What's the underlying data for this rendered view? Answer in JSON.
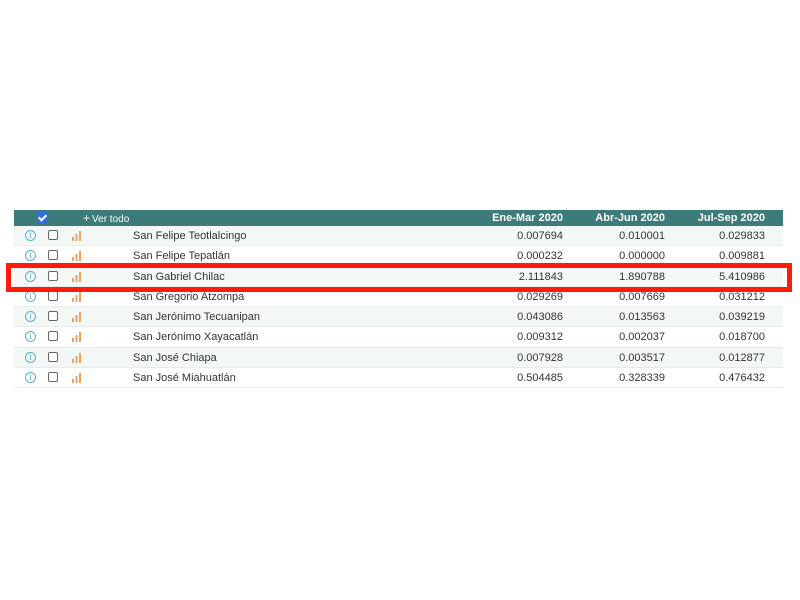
{
  "header": {
    "ver_todo": "Ver todo",
    "columns": [
      "Ene-Mar 2020",
      "Abr-Jun 2020",
      "Jul-Sep 2020"
    ]
  },
  "rows": [
    {
      "name": "San Felipe Teotlalcingo",
      "v1": "0.007694",
      "v2": "0.010001",
      "v3": "0.029833"
    },
    {
      "name": "San Felipe Tepatlán",
      "v1": "0.000232",
      "v2": "0.000000",
      "v3": "0.009881"
    },
    {
      "name": "San Gabriel Chilac",
      "v1": "2.111843",
      "v2": "1.890788",
      "v3": "5.410986"
    },
    {
      "name": "San Gregorio Atzompa",
      "v1": "0.029269",
      "v2": "0.007669",
      "v3": "0.031212"
    },
    {
      "name": "San Jerónimo Tecuanipan",
      "v1": "0.043086",
      "v2": "0.013563",
      "v3": "0.039219"
    },
    {
      "name": "San Jerónimo Xayacatlán",
      "v1": "0.009312",
      "v2": "0.002037",
      "v3": "0.018700"
    },
    {
      "name": "San José Chiapa",
      "v1": "0.007928",
      "v2": "0.003517",
      "v3": "0.012877"
    },
    {
      "name": "San José Miahuatlán",
      "v1": "0.504485",
      "v2": "0.328339",
      "v3": "0.476432"
    }
  ],
  "icons": {
    "info": "info-icon",
    "chart": "bar-chart-icon"
  },
  "colors": {
    "header_bg": "#3d7a7a",
    "highlight": "#ff1a0a",
    "chart_icon": "#f0a060",
    "info_icon": "#5ab0c4"
  }
}
